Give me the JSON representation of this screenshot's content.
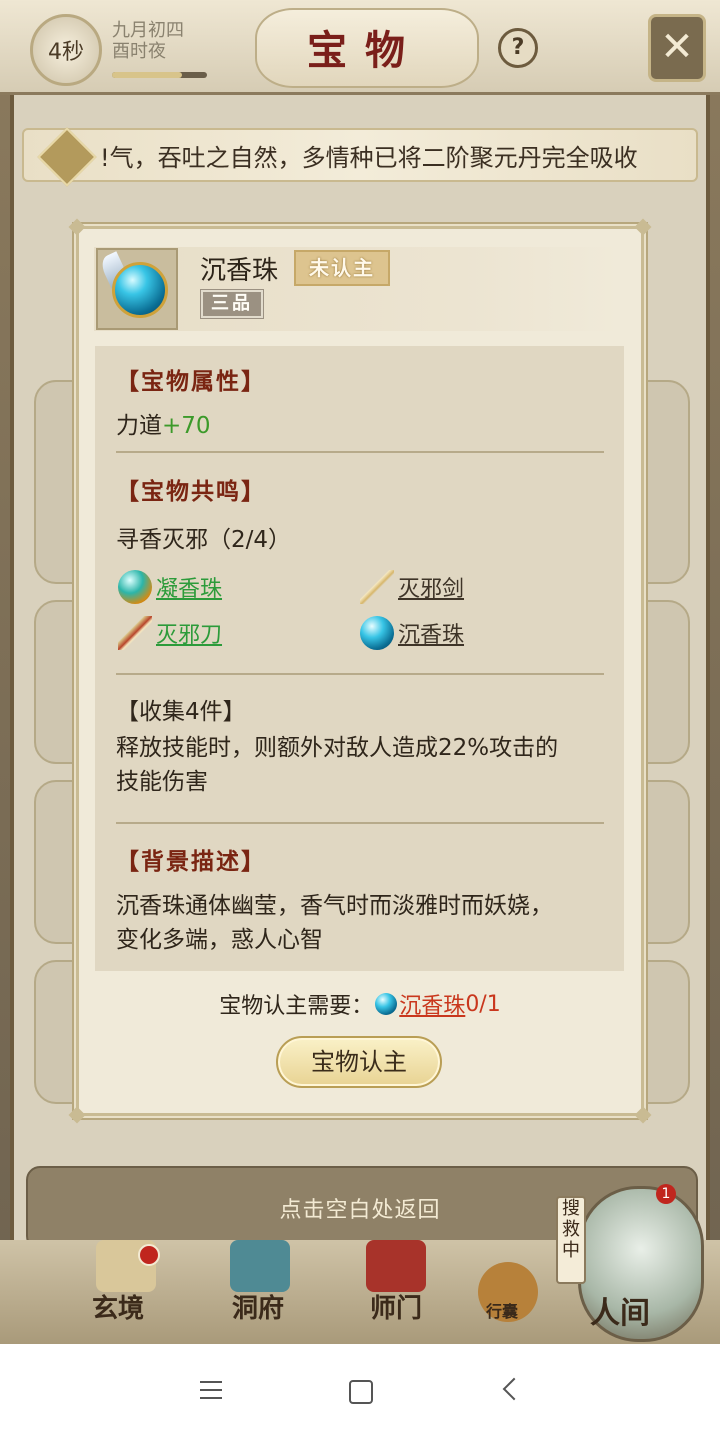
{
  "header": {
    "timer": "4秒",
    "date_line1": "九月初四",
    "date_line2": "酉时夜",
    "title": "宝物",
    "help": "?",
    "close": "✕"
  },
  "notice": {
    "text": "!气，吞吐之自然，多情种已将二阶聚元丹完全吸收"
  },
  "modal": {
    "item_name": "沉香珠",
    "status_tag": "未认主",
    "grade_tag": "三品",
    "attr_title": "【宝物属性】",
    "attr_label": "力道",
    "attr_value": "+70",
    "resonance_title": "【宝物共鸣】",
    "set_name": "寻香灭邪（2/4）",
    "set_items": [
      {
        "name": "凝香珠",
        "icon": "pearl-gold-icon"
      },
      {
        "name": "灭邪剑",
        "icon": "sword-icon"
      },
      {
        "name": "灭邪刀",
        "icon": "blade-icon"
      },
      {
        "name": "沉香珠",
        "icon": "pearl-blue-icon"
      }
    ],
    "bonus_title": "【收集4件】",
    "bonus_line1": "释放技能时，则额外对敌人造成22%攻击的",
    "bonus_line2": "技能伤害",
    "bg_title": "【背景描述】",
    "bg_line1": "沉香珠通体幽莹，香气时而淡雅时而妖娆，",
    "bg_line2": "变化多端，惑人心智",
    "req_label": "宝物认主需要：",
    "req_item": "沉香珠",
    "req_count": "0/1",
    "claim_button": "宝物认主"
  },
  "hint": "点击空白处返回",
  "bottom_nav": {
    "items": [
      "玄境",
      "洞府",
      "师门",
      "行囊",
      "人间"
    ],
    "search_tag": "搜救中",
    "badge": "1"
  },
  "colors": {
    "title_red": "#7a1f1a",
    "section_title": "#7a2512",
    "green_value": "#3c9a2a",
    "link_green": "#2c9b3a",
    "link_red": "#c9371d"
  }
}
